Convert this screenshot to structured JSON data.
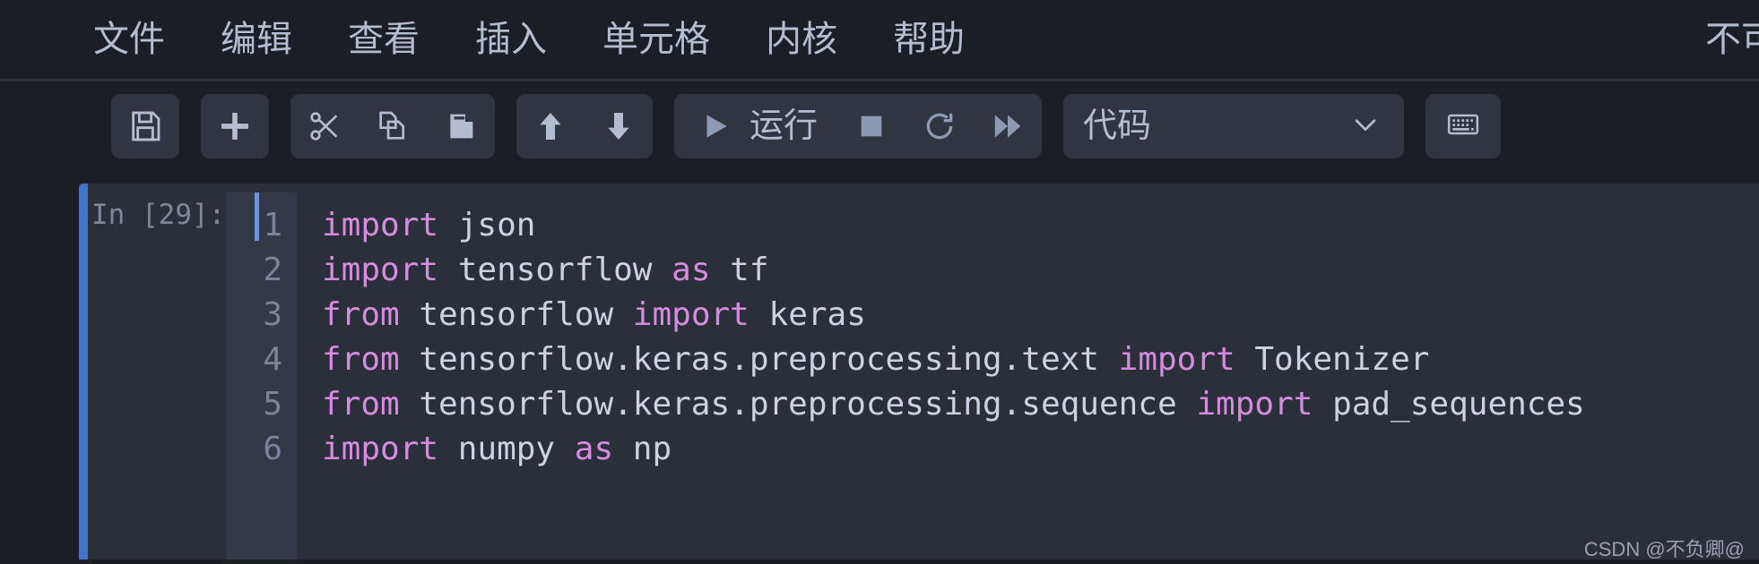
{
  "colors": {
    "app_background": "#1b1e25",
    "toolbar_button": "#313542",
    "cell_background": "#2b2f3a",
    "gutter_background": "#343948",
    "selection_bar": "#4274c7",
    "text_primary": "#b4bdd0",
    "code_text": "#ccd2e0",
    "code_keyword": "#d58ce0",
    "line_number": "#79839a",
    "prompt_text": "#7f8796"
  },
  "menubar": {
    "items": [
      {
        "label": "文件",
        "name": "menu-file"
      },
      {
        "label": "编辑",
        "name": "menu-edit"
      },
      {
        "label": "查看",
        "name": "menu-view"
      },
      {
        "label": "插入",
        "name": "menu-insert"
      },
      {
        "label": "单元格",
        "name": "menu-cell"
      },
      {
        "label": "内核",
        "name": "menu-kernel"
      },
      {
        "label": "帮助",
        "name": "menu-help"
      }
    ],
    "trust_indicator": "不可"
  },
  "toolbar": {
    "save_icon": "floppy-disk-save-icon",
    "add_icon": "plus-add-cell-icon",
    "cut_icon": "scissors-cut-icon",
    "copy_icon": "copy-icon",
    "paste_icon": "paste-icon",
    "move_up_icon": "arrow-up-icon",
    "move_down_icon": "arrow-down-icon",
    "run_icon": "play-run-icon",
    "run_label": "运行",
    "stop_icon": "stop-square-icon",
    "restart_icon": "restart-circular-arrow-icon",
    "restart_run_all_icon": "fast-forward-double-triangle-icon",
    "cell_type_value": "代码",
    "cell_type_chevron": "chevron-down-icon",
    "keyboard_icon": "keyboard-icon"
  },
  "notebook": {
    "cell": {
      "prompt": "In [29]:",
      "line_numbers": [
        "1",
        "2",
        "3",
        "4",
        "5",
        "6"
      ],
      "lines": [
        [
          {
            "t": "import",
            "c": "kw"
          },
          {
            "t": " json",
            "c": "id"
          }
        ],
        [
          {
            "t": "import",
            "c": "kw"
          },
          {
            "t": " tensorflow ",
            "c": "id"
          },
          {
            "t": "as",
            "c": "kw"
          },
          {
            "t": " tf",
            "c": "id"
          }
        ],
        [
          {
            "t": "from",
            "c": "kw"
          },
          {
            "t": " tensorflow ",
            "c": "id"
          },
          {
            "t": "import",
            "c": "kw"
          },
          {
            "t": " keras",
            "c": "id"
          }
        ],
        [
          {
            "t": "from",
            "c": "kw"
          },
          {
            "t": " tensorflow.keras.preprocessing.text ",
            "c": "id"
          },
          {
            "t": "import",
            "c": "kw"
          },
          {
            "t": " Tokenizer",
            "c": "id"
          }
        ],
        [
          {
            "t": "from",
            "c": "kw"
          },
          {
            "t": " tensorflow.keras.preprocessing.sequence ",
            "c": "id"
          },
          {
            "t": "import",
            "c": "kw"
          },
          {
            "t": " pad_sequences",
            "c": "id"
          }
        ],
        [
          {
            "t": "import",
            "c": "kw"
          },
          {
            "t": " numpy ",
            "c": "id"
          },
          {
            "t": "as",
            "c": "kw"
          },
          {
            "t": " np",
            "c": "id"
          }
        ]
      ]
    }
  },
  "watermark": "CSDN @不负卿@"
}
